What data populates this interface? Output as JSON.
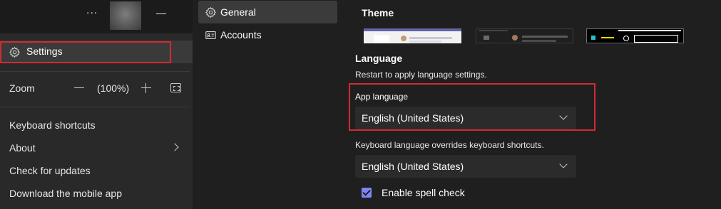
{
  "menu": {
    "more_label": "...",
    "settings_label": "Settings",
    "zoom": {
      "label": "Zoom",
      "value": "(100%)"
    },
    "links": [
      "Keyboard shortcuts",
      "About",
      "Check for updates",
      "Download the mobile app"
    ]
  },
  "nav": {
    "items": [
      {
        "label": "General",
        "icon": "gear-icon",
        "active": true
      },
      {
        "label": "Accounts",
        "icon": "id-card-icon",
        "active": false
      }
    ]
  },
  "content": {
    "theme": {
      "title": "Theme",
      "options": [
        "default",
        "dark",
        "high-contrast"
      ]
    },
    "language": {
      "title": "Language",
      "hint": "Restart to apply language settings.",
      "app_language_label": "App language",
      "app_language_value": "English (United States)",
      "keyboard_hint": "Keyboard language overrides keyboard shortcuts.",
      "keyboard_language_value": "English (United States)"
    },
    "spell_check": {
      "label": "Enable spell check",
      "checked": true
    }
  },
  "colors": {
    "background": "#1f1f1f",
    "menu_background": "#292929",
    "highlight": "#d22b33",
    "accent": "#7f85f5"
  }
}
